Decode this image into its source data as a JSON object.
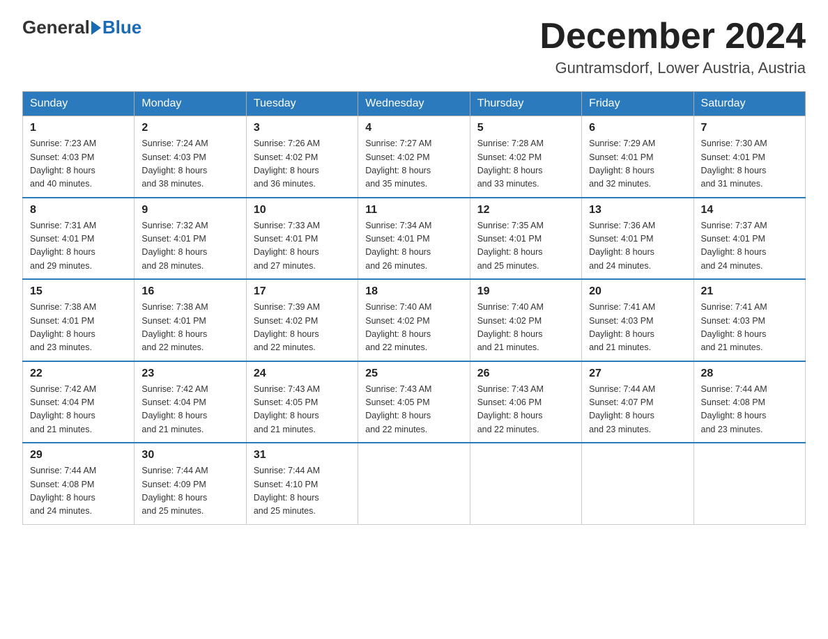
{
  "header": {
    "logo_general": "General",
    "logo_blue": "Blue",
    "month_title": "December 2024",
    "location": "Guntramsdorf, Lower Austria, Austria"
  },
  "weekdays": [
    "Sunday",
    "Monday",
    "Tuesday",
    "Wednesday",
    "Thursday",
    "Friday",
    "Saturday"
  ],
  "weeks": [
    [
      {
        "day": "1",
        "sunrise": "7:23 AM",
        "sunset": "4:03 PM",
        "daylight": "8 hours and 40 minutes."
      },
      {
        "day": "2",
        "sunrise": "7:24 AM",
        "sunset": "4:03 PM",
        "daylight": "8 hours and 38 minutes."
      },
      {
        "day": "3",
        "sunrise": "7:26 AM",
        "sunset": "4:02 PM",
        "daylight": "8 hours and 36 minutes."
      },
      {
        "day": "4",
        "sunrise": "7:27 AM",
        "sunset": "4:02 PM",
        "daylight": "8 hours and 35 minutes."
      },
      {
        "day": "5",
        "sunrise": "7:28 AM",
        "sunset": "4:02 PM",
        "daylight": "8 hours and 33 minutes."
      },
      {
        "day": "6",
        "sunrise": "7:29 AM",
        "sunset": "4:01 PM",
        "daylight": "8 hours and 32 minutes."
      },
      {
        "day": "7",
        "sunrise": "7:30 AM",
        "sunset": "4:01 PM",
        "daylight": "8 hours and 31 minutes."
      }
    ],
    [
      {
        "day": "8",
        "sunrise": "7:31 AM",
        "sunset": "4:01 PM",
        "daylight": "8 hours and 29 minutes."
      },
      {
        "day": "9",
        "sunrise": "7:32 AM",
        "sunset": "4:01 PM",
        "daylight": "8 hours and 28 minutes."
      },
      {
        "day": "10",
        "sunrise": "7:33 AM",
        "sunset": "4:01 PM",
        "daylight": "8 hours and 27 minutes."
      },
      {
        "day": "11",
        "sunrise": "7:34 AM",
        "sunset": "4:01 PM",
        "daylight": "8 hours and 26 minutes."
      },
      {
        "day": "12",
        "sunrise": "7:35 AM",
        "sunset": "4:01 PM",
        "daylight": "8 hours and 25 minutes."
      },
      {
        "day": "13",
        "sunrise": "7:36 AM",
        "sunset": "4:01 PM",
        "daylight": "8 hours and 24 minutes."
      },
      {
        "day": "14",
        "sunrise": "7:37 AM",
        "sunset": "4:01 PM",
        "daylight": "8 hours and 24 minutes."
      }
    ],
    [
      {
        "day": "15",
        "sunrise": "7:38 AM",
        "sunset": "4:01 PM",
        "daylight": "8 hours and 23 minutes."
      },
      {
        "day": "16",
        "sunrise": "7:38 AM",
        "sunset": "4:01 PM",
        "daylight": "8 hours and 22 minutes."
      },
      {
        "day": "17",
        "sunrise": "7:39 AM",
        "sunset": "4:02 PM",
        "daylight": "8 hours and 22 minutes."
      },
      {
        "day": "18",
        "sunrise": "7:40 AM",
        "sunset": "4:02 PM",
        "daylight": "8 hours and 22 minutes."
      },
      {
        "day": "19",
        "sunrise": "7:40 AM",
        "sunset": "4:02 PM",
        "daylight": "8 hours and 21 minutes."
      },
      {
        "day": "20",
        "sunrise": "7:41 AM",
        "sunset": "4:03 PM",
        "daylight": "8 hours and 21 minutes."
      },
      {
        "day": "21",
        "sunrise": "7:41 AM",
        "sunset": "4:03 PM",
        "daylight": "8 hours and 21 minutes."
      }
    ],
    [
      {
        "day": "22",
        "sunrise": "7:42 AM",
        "sunset": "4:04 PM",
        "daylight": "8 hours and 21 minutes."
      },
      {
        "day": "23",
        "sunrise": "7:42 AM",
        "sunset": "4:04 PM",
        "daylight": "8 hours and 21 minutes."
      },
      {
        "day": "24",
        "sunrise": "7:43 AM",
        "sunset": "4:05 PM",
        "daylight": "8 hours and 21 minutes."
      },
      {
        "day": "25",
        "sunrise": "7:43 AM",
        "sunset": "4:05 PM",
        "daylight": "8 hours and 22 minutes."
      },
      {
        "day": "26",
        "sunrise": "7:43 AM",
        "sunset": "4:06 PM",
        "daylight": "8 hours and 22 minutes."
      },
      {
        "day": "27",
        "sunrise": "7:44 AM",
        "sunset": "4:07 PM",
        "daylight": "8 hours and 23 minutes."
      },
      {
        "day": "28",
        "sunrise": "7:44 AM",
        "sunset": "4:08 PM",
        "daylight": "8 hours and 23 minutes."
      }
    ],
    [
      {
        "day": "29",
        "sunrise": "7:44 AM",
        "sunset": "4:08 PM",
        "daylight": "8 hours and 24 minutes."
      },
      {
        "day": "30",
        "sunrise": "7:44 AM",
        "sunset": "4:09 PM",
        "daylight": "8 hours and 25 minutes."
      },
      {
        "day": "31",
        "sunrise": "7:44 AM",
        "sunset": "4:10 PM",
        "daylight": "8 hours and 25 minutes."
      },
      null,
      null,
      null,
      null
    ]
  ],
  "labels": {
    "sunrise": "Sunrise:",
    "sunset": "Sunset:",
    "daylight": "Daylight:"
  }
}
